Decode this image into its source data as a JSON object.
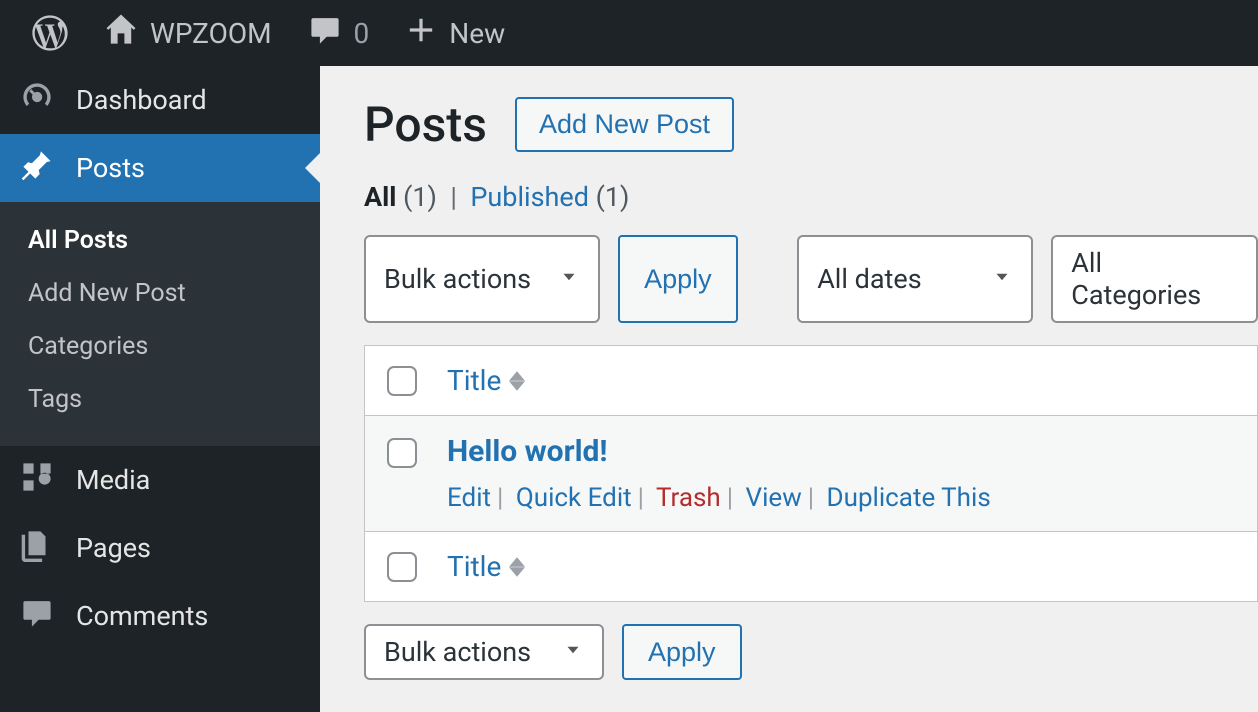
{
  "topbar": {
    "site_name": "WPZOOM",
    "comments": "0",
    "new_label": "New"
  },
  "sidebar": {
    "dashboard": "Dashboard",
    "posts": "Posts",
    "submenu": {
      "all": "All Posts",
      "add": "Add New Post",
      "categories": "Categories",
      "tags": "Tags"
    },
    "media": "Media",
    "pages": "Pages",
    "comments": "Comments"
  },
  "main": {
    "heading": "Posts",
    "add_button": "Add New Post",
    "filter_tabs": {
      "all": "All",
      "all_count": "(1)",
      "published": "Published",
      "published_count": "(1)"
    },
    "bulk_label": "Bulk actions",
    "apply_label": "Apply",
    "date_filter": "All dates",
    "category_filter": "All Categories",
    "col_title": "Title",
    "row": {
      "title": "Hello world!",
      "edit": "Edit",
      "quick": "Quick Edit",
      "trash": "Trash",
      "view": "View",
      "dup": "Duplicate This"
    }
  }
}
